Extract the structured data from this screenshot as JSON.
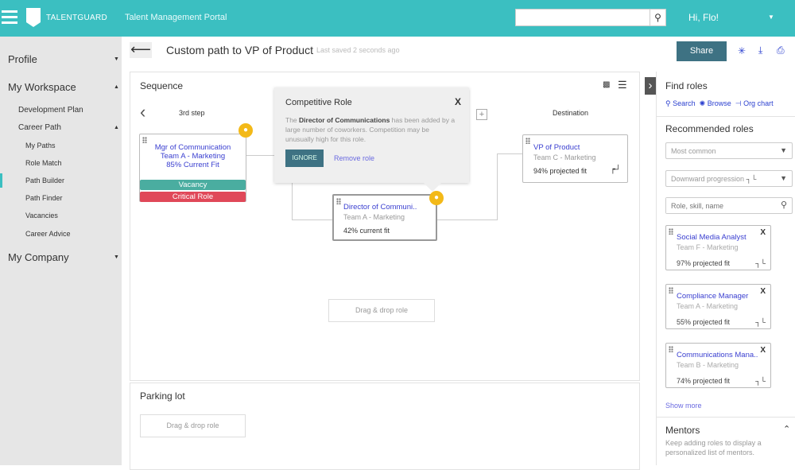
{
  "header": {
    "brand": "TALENTGUARD",
    "portal": "Talent Management Portal",
    "search_placeholder": "",
    "greeting": "Hi, Flo!",
    "accent": "#3bbfc1"
  },
  "sidebar": {
    "profile": "Profile",
    "workspace": "My Workspace",
    "development_plan": "Development Plan",
    "career_path": "Career Path",
    "items": [
      "My Paths",
      "Role Match",
      "Path Builder",
      "Path Finder",
      "Vacancies",
      "Career Advice"
    ],
    "active": "Path Builder",
    "company": "My Company"
  },
  "page": {
    "title": "Custom path to VP of Product",
    "saved": "Last saved 2 seconds ago",
    "share": "Share"
  },
  "sequence": {
    "title": "Sequence",
    "step_label": "3rd step",
    "destination_label": "Destination",
    "step_card": {
      "title": "Mgr of Communication",
      "team": "Team A - Marketing",
      "fit": "85% Current Fit",
      "badge1": "Vacancy",
      "badge2": "Critical Role"
    },
    "director_card": {
      "title": "Director of Communi..",
      "team": "Team A - Marketing",
      "fit": "42% current fit"
    },
    "destination_card": {
      "title": "VP of Product",
      "team": "Team C - Marketing",
      "fit": "94% projected fit"
    },
    "drag_drop": "Drag & drop role"
  },
  "popup": {
    "title": "Competitive Role",
    "text_pre": "The ",
    "text_bold": "Director of Communications",
    "text_post": " has been added by a large number of coworkers. Competition may be unusually high for this role.",
    "ignore": "IGNORE",
    "remove": "Remove role",
    "close": "X"
  },
  "parking": {
    "title": "Parking lot",
    "drag_drop": "Drag & drop role"
  },
  "find_roles": {
    "title": "Find roles",
    "search": "Search",
    "browse": "Browse",
    "org_chart": "Org chart"
  },
  "recommended": {
    "title": "Recommended roles",
    "sort": "Most common",
    "progression": "Downward progression",
    "search_placeholder": "Role, skill, name",
    "cards": [
      {
        "title": "Social Media Analyst",
        "team": "Team F - Marketing",
        "fit": "97% projected fit"
      },
      {
        "title": "Compliance Manager",
        "team": "Team A - Marketing",
        "fit": "55% projected fit"
      },
      {
        "title": "Communications Mana..",
        "team": "Team B - Marketing",
        "fit": "74% projected fit"
      }
    ],
    "show_more": "Show more"
  },
  "mentors": {
    "title": "Mentors",
    "text": "Keep adding roles to display a personalized list of mentors."
  }
}
